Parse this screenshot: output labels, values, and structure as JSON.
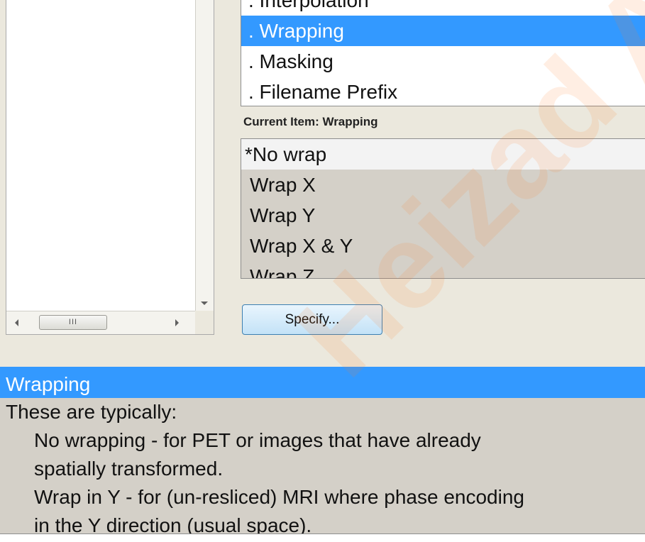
{
  "options_list": {
    "items": [
      ". Interpolation",
      ". Wrapping",
      ". Masking",
      ". Filename Prefix"
    ],
    "selected_index": 1
  },
  "current_item": {
    "label": "Current Item: Wrapping"
  },
  "choices_list": {
    "items": [
      "*No wrap",
      "Wrap X",
      "Wrap Y",
      "Wrap X & Y",
      "Wrap Z"
    ],
    "current_index": 0
  },
  "specify_button": {
    "label": "Specify..."
  },
  "left_panel": {
    "hscroll_thumb_label": "III"
  },
  "help": {
    "title": "Wrapping",
    "lines": [
      "These are typically:",
      "No  wrapping  -  for  PET or images that have already",
      "spatially transformed.",
      "Wrap in  Y  - for (un-resliced) MRI where phase encoding",
      "in the Y direction (usual space)."
    ]
  },
  "watermark": {
    "text": "Heizad An"
  },
  "colors": {
    "selection": "#3399ff",
    "panel_bg": "#d4d0c8",
    "window_bg": "#ebe8dd",
    "button_border": "#3c7fb1"
  }
}
